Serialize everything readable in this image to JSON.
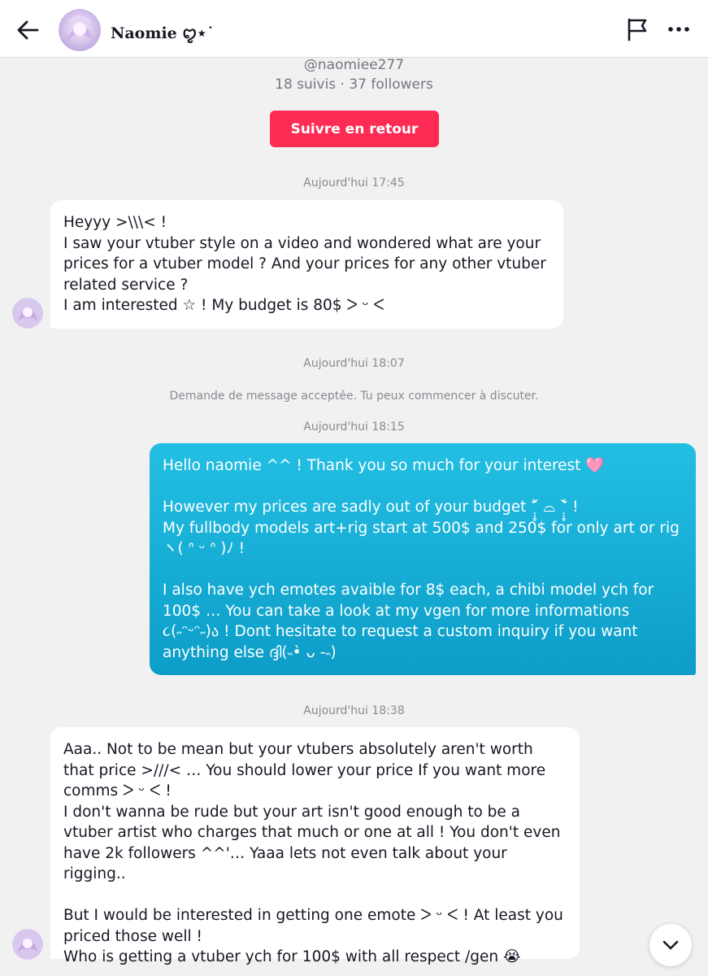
{
  "header": {
    "contact_name": "Naomie ꨄ︎⋆˙",
    "back_icon": "arrow-left-icon",
    "flag_icon": "flag-icon",
    "more_icon": "more-horizontal-icon"
  },
  "profile": {
    "handle": "@naomiee277",
    "stats": "18 suivis · 37 followers",
    "follow_back_label": "Suivre en retour"
  },
  "colors": {
    "accent": "#fe2c55",
    "outgoing_bubble": "#0c9dc8",
    "incoming_bubble": "#ffffff",
    "background": "#f1f1f2"
  },
  "conversation": {
    "ts1": "Aujourd'hui 17:45",
    "msg1": "Heyyy >\\\\\\< !\nI saw your vtuber style on a video and wondered what are your prices for a vtuber model ? And your prices for any other vtuber related service ?\nI am interested ☆ ! My budget is 80$ ᐳ ᵕ ᐸ",
    "ts2": "Aujourd'hui 18:07",
    "system_msg": "Demande de message acceptée. Tu peux commencer à discuter.",
    "ts3": "Aujourd'hui 18:15",
    "msg2": "Hello naomie ^^ ! Thank you so much for your interest 🩷\n\nHowever my prices are sadly out of your budget ˃̣̣̥᷄ ⌓ ˂̣̣̥᷅ !\nMy fullbody models art+rig start at 500$ and 250$ for only art or rig ヽ( ᐢ ᵕ ᐢ )ﾉ !\n\nI also have ych emotes avaible for 8$ each, a chibi model ych for 100$ … You can take a look at my vgen for more informations ૮(˶ᵔᵕᵔ˶)ა ! Dont hesitate to request a custom inquiry if you want anything else ദ്ദി(˵•̀ ᴗ -˵)",
    "ts4": "Aujourd'hui 18:38",
    "msg3": "Aaa.. Not to be mean but your vtubers absolutely aren't worth that price >///< … You should lower your price If you want more comms ᐳ ᵕ ᐸ !\nI don't wanna be rude but your art isn't good enough to be a vtuber artist who charges that much or one at all ! You don't even have 2k followers ^^'… Yaaa lets not even talk about your rigging..\n\nBut I would be interested in getting one emote ᐳ ᵕ ᐸ ! At least you priced those well !\nWho is getting a vtuber ych for 100$ with all respect /gen 😭"
  },
  "scroll_icon": "chevron-down-icon"
}
